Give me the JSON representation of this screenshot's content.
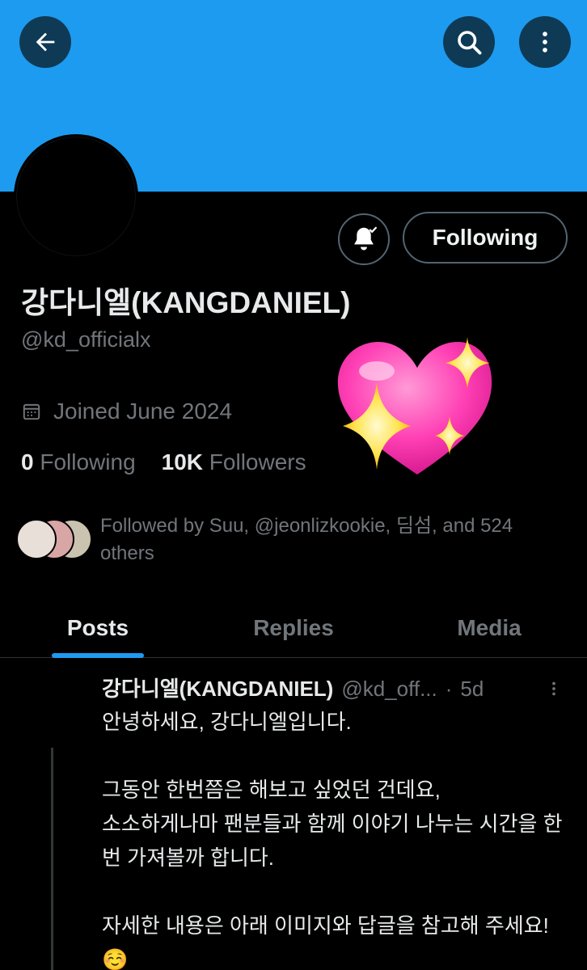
{
  "header": {
    "back_icon": "arrow-left-icon",
    "search_icon": "search-icon",
    "more_icon": "more-vertical-icon",
    "banner_color": "#1d9bf0"
  },
  "profile": {
    "display_name": "강다니엘(KANGDANIEL)",
    "handle": "@kd_officialx",
    "joined": "Joined June 2024",
    "following_count": "0",
    "following_label": "Following",
    "followers_count": "10K",
    "followers_label": "Followers",
    "follow_button_label": "Following",
    "followed_by": "Followed by Suu, @jeonlizkookie, 딤섬, and 524 others"
  },
  "tabs": [
    {
      "label": "Posts",
      "active": true
    },
    {
      "label": "Replies",
      "active": false
    },
    {
      "label": "Media",
      "active": false
    }
  ],
  "post": {
    "author_name": "강다니엘(KANGDANIEL)",
    "author_handle": "@kd_off...",
    "separator": "·",
    "time": "5d",
    "paragraphs": [
      "안녕하세요, 강다니엘입니다.",
      "그동안 한번쯤은 해보고 싶었던 건데요,\n소소하게나마 팬분들과 함께 이야기 나누는 시간을 한번 가져볼까 합니다.",
      "자세한 내용은 아래 이미지와 답글을 참고해 주세요!☺️"
    ]
  },
  "colors": {
    "accent": "#1d9bf0",
    "muted_text": "#71767b",
    "border": "#536471"
  }
}
